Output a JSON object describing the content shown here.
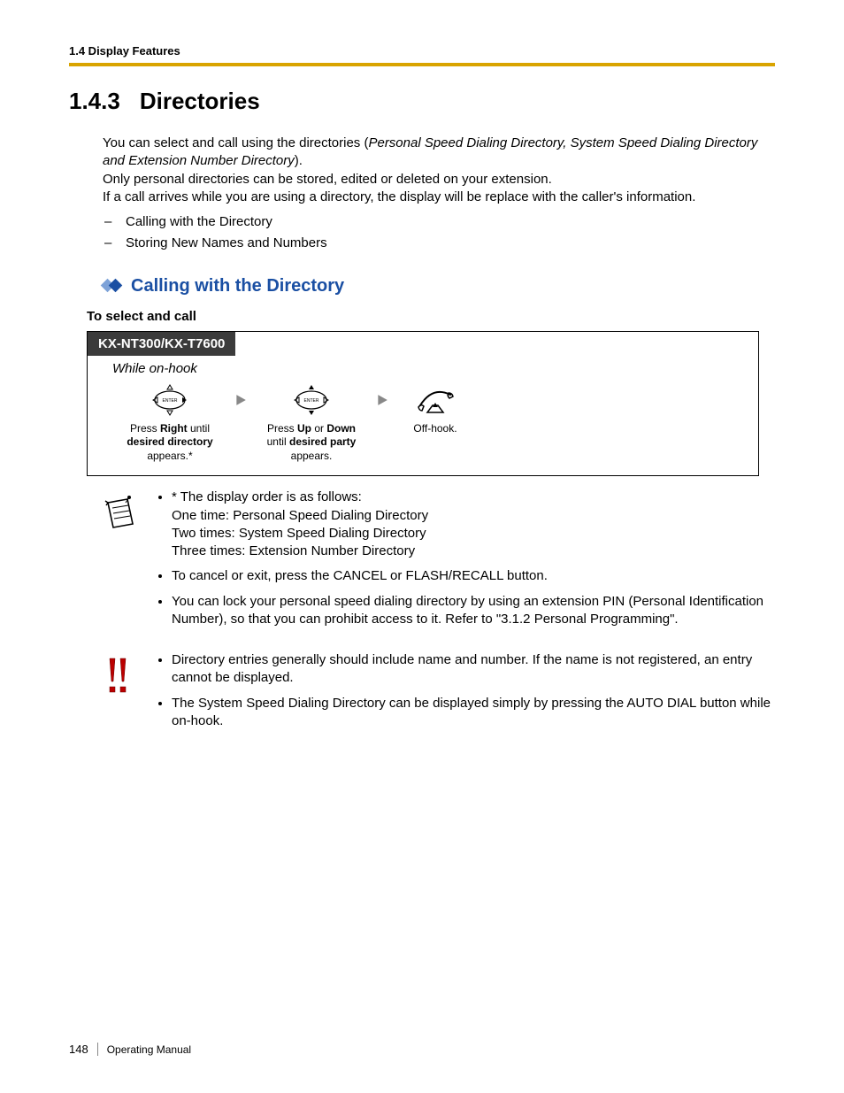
{
  "header": {
    "running": "1.4 Display Features"
  },
  "title": {
    "number": "1.4.3",
    "text": "Directories"
  },
  "intro": {
    "line1a": "You can select and call using the directories (",
    "line1b": "Personal Speed Dialing Directory, System Speed Dialing Directory and Extension Number Directory",
    "line1c": ").",
    "line2": "Only personal directories can be stored, edited or deleted on your extension.",
    "line3": "If a call arrives while you are using a directory, the display will be replace with the caller's information.",
    "bullets": [
      "Calling with the Directory",
      "Storing New Names and Numbers"
    ]
  },
  "subheading": "Calling with the Directory",
  "step_heading": "To select and call",
  "procedure": {
    "model": "KX-NT300/KX-T7600",
    "state": "While on-hook",
    "step1": {
      "a": "Press ",
      "b": "Right",
      "c": " until ",
      "d": "desired directory",
      "e": " appears.*"
    },
    "step2": {
      "a": "Press ",
      "b": "Up",
      "c": " or ",
      "d": "Down",
      "e": " until ",
      "f": "desired party",
      "g": " appears."
    },
    "step3": "Off-hook."
  },
  "note_set_1": [
    "* The display order is as follows:\nOne time: Personal Speed Dialing Directory\nTwo times: System Speed Dialing Directory\nThree times: Extension Number Directory",
    "To cancel or exit, press the CANCEL or FLASH/RECALL button.",
    "You can lock your personal speed dialing directory by using an extension PIN (Personal Identification Number), so that you can prohibit access to it. Refer to \"3.1.2 Personal Programming\"."
  ],
  "note_set_2": [
    "Directory entries generally should include name and number. If the name is not registered, an entry cannot be displayed.",
    "The System Speed Dialing Directory can be displayed simply by pressing the AUTO DIAL button while on-hook."
  ],
  "footer": {
    "page": "148",
    "manual": "Operating Manual"
  }
}
